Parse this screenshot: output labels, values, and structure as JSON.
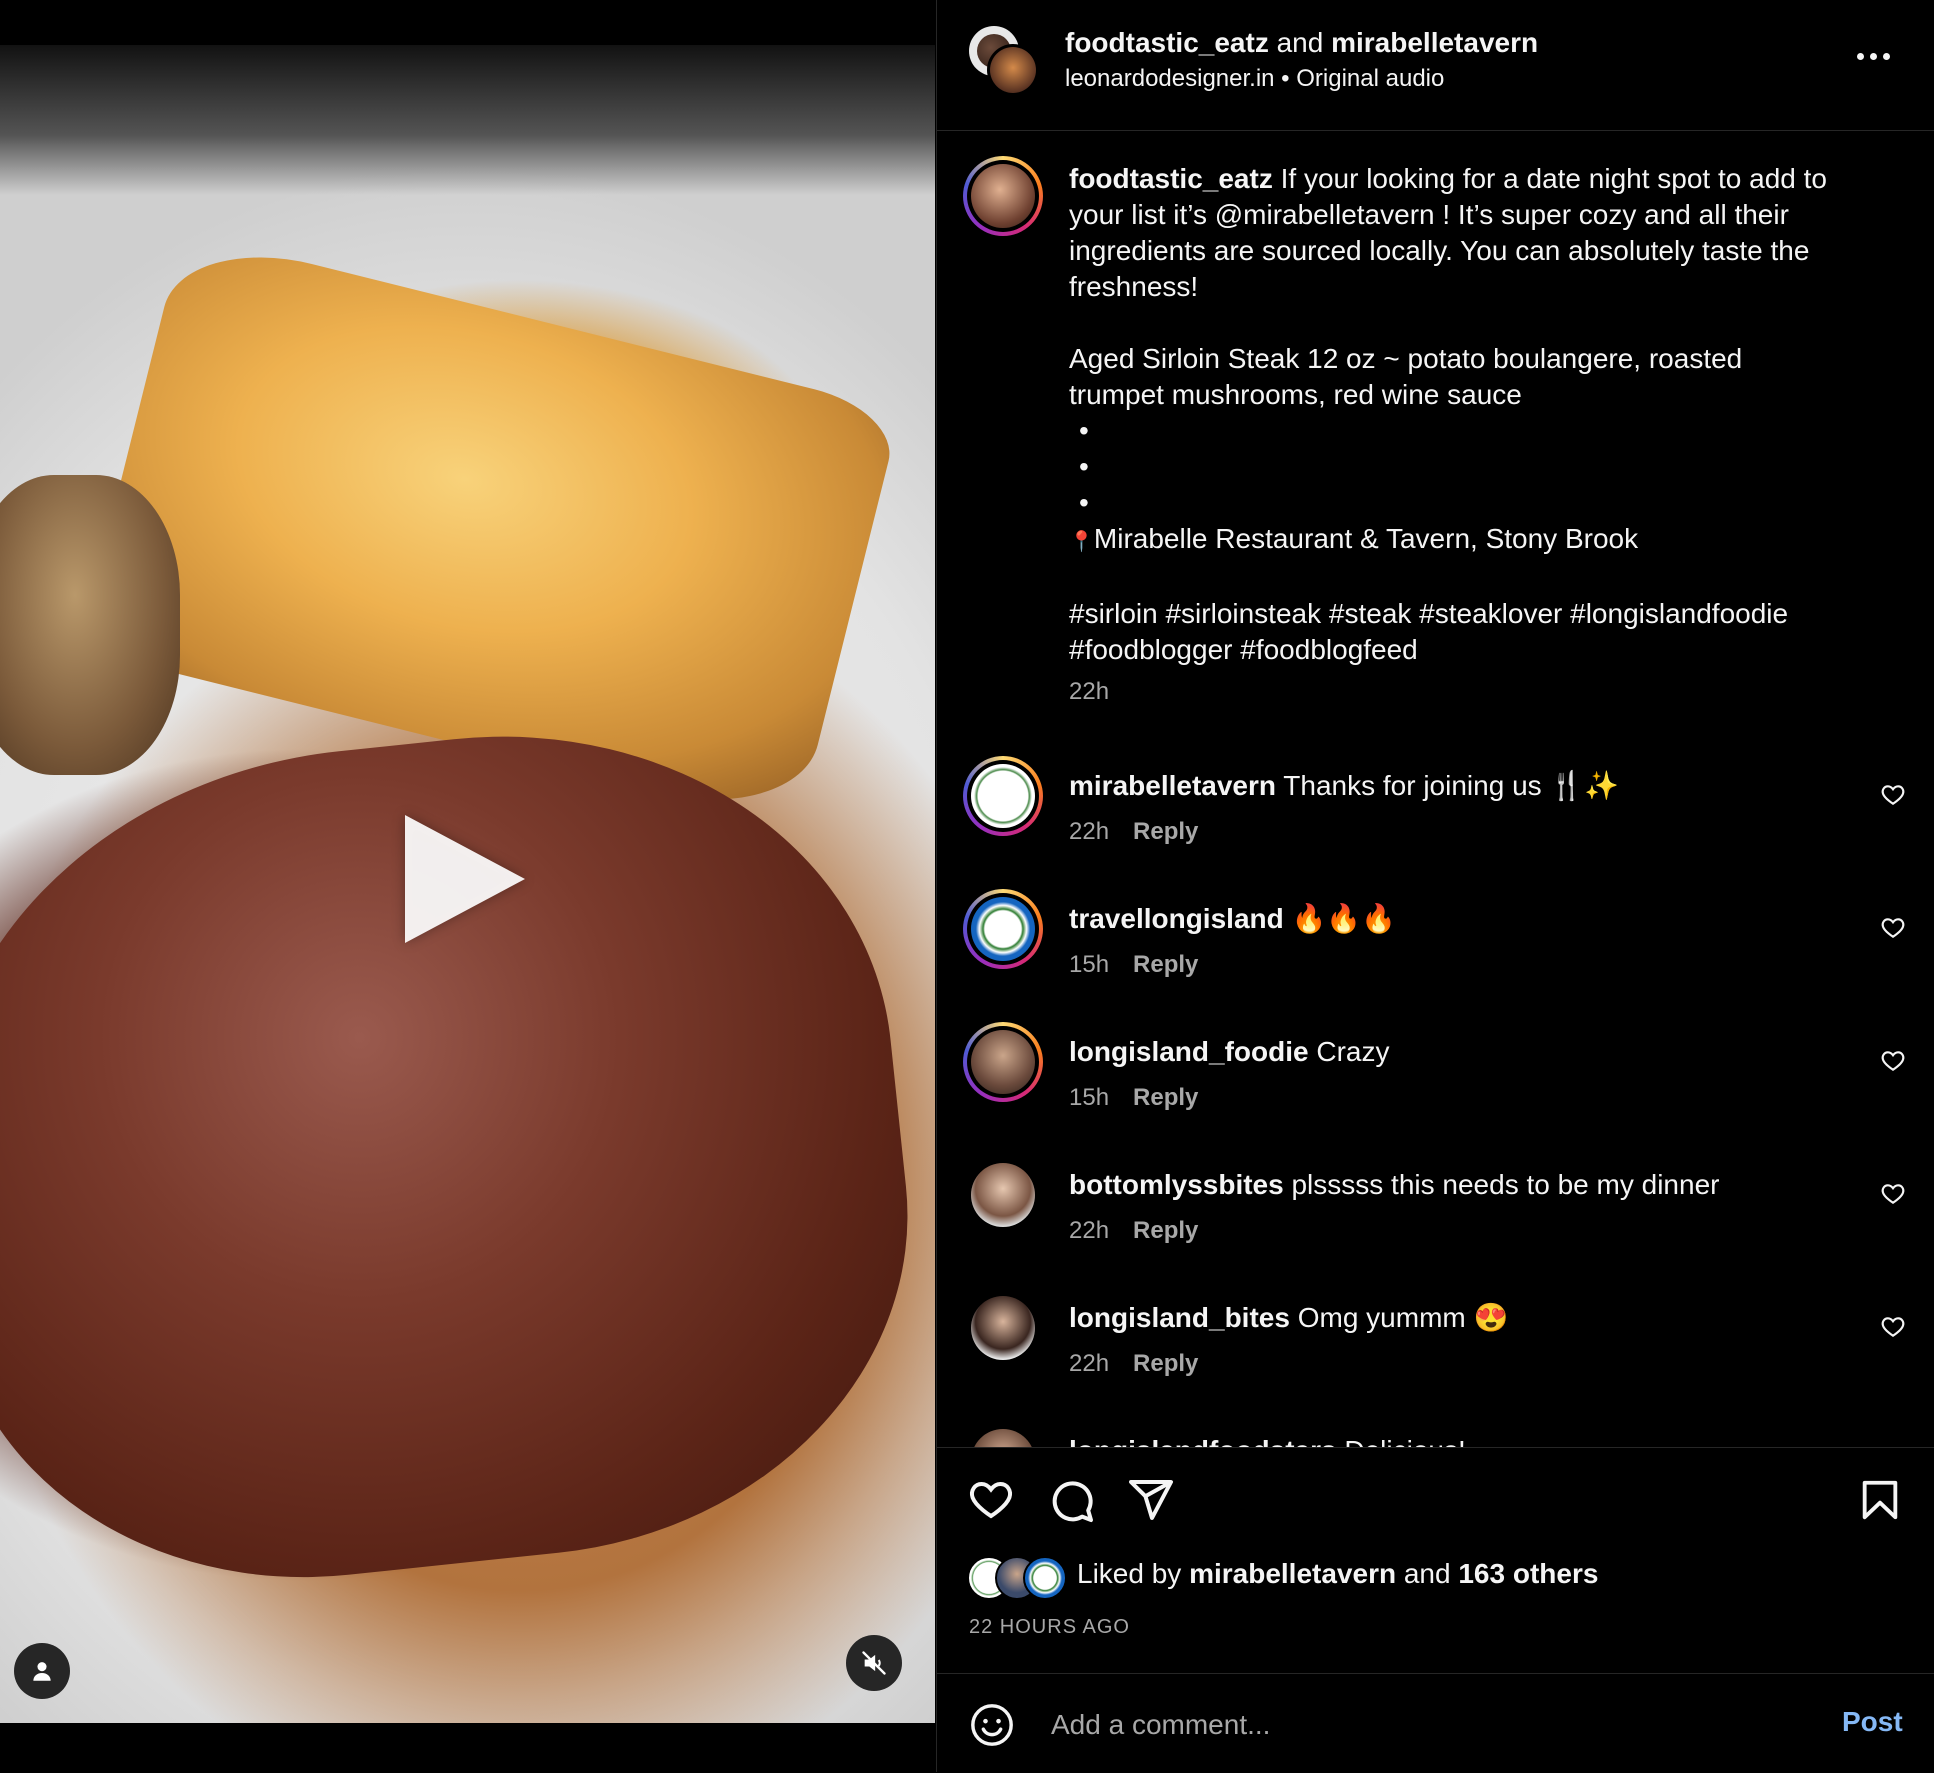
{
  "header": {
    "author": "foodtastic_eatz",
    "joiner": "and",
    "collaborator": "mirabelletavern",
    "audio_source": "leonardodesigner.in",
    "separator": "•",
    "audio_label": "Original audio"
  },
  "caption": {
    "username": "foodtastic_eatz",
    "paragraph1": "If your looking for a date night spot to add to your list it’s @mirabelletavern ! It’s super cozy and all their ingredients are sourced locally. You can absolutely taste the freshness!",
    "paragraph2": "Aged Sirloin Steak 12 oz ~ potato boulangere, roasted trumpet mushrooms, red wine sauce",
    "dot": "•",
    "location_pin": "📍",
    "location": "Mirabelle Restaurant & Tavern, Stony Brook",
    "hashtags": "#sirloin #sirloinsteak #steak #steaklover #longislandfoodie #foodblogger #foodblogfeed",
    "time": "22h"
  },
  "comments": [
    {
      "username": "mirabelletavern",
      "text": "Thanks for joining us 🍴✨",
      "time": "22h",
      "reply": "Reply"
    },
    {
      "username": "travellongisland",
      "text": "🔥🔥🔥",
      "time": "15h",
      "reply": "Reply"
    },
    {
      "username": "longisland_foodie",
      "text": "Crazy",
      "time": "15h",
      "reply": "Reply"
    },
    {
      "username": "bottomlyssbites",
      "text": "plsssss this needs to be my dinner",
      "time": "22h",
      "reply": "Reply"
    },
    {
      "username": "longisland_bites",
      "text": "Omg yummm 😍",
      "time": "22h",
      "reply": "Reply"
    },
    {
      "username": "longislandfoodstars",
      "text": "Delicious!",
      "time": "",
      "reply": ""
    }
  ],
  "likes": {
    "prefix": "Liked by",
    "user": "mirabelletavern",
    "joiner": "and",
    "others": "163 others"
  },
  "post_time": "22 HOURS AGO",
  "comment_box": {
    "placeholder": "Add a comment...",
    "post_label": "Post"
  },
  "icons": {
    "play": "play-icon",
    "mute": "muted-speaker-icon",
    "tag": "person-icon",
    "like": "heart-icon",
    "comment": "speech-bubble-icon",
    "share": "paper-plane-icon",
    "save": "bookmark-icon",
    "emoji": "smiley-icon",
    "more": "ellipsis-icon"
  },
  "colors": {
    "background": "#000000",
    "text": "#f5f5f5",
    "secondary_text": "#a8a8a8",
    "post_button": "#85b8f5",
    "divider": "#262626"
  }
}
